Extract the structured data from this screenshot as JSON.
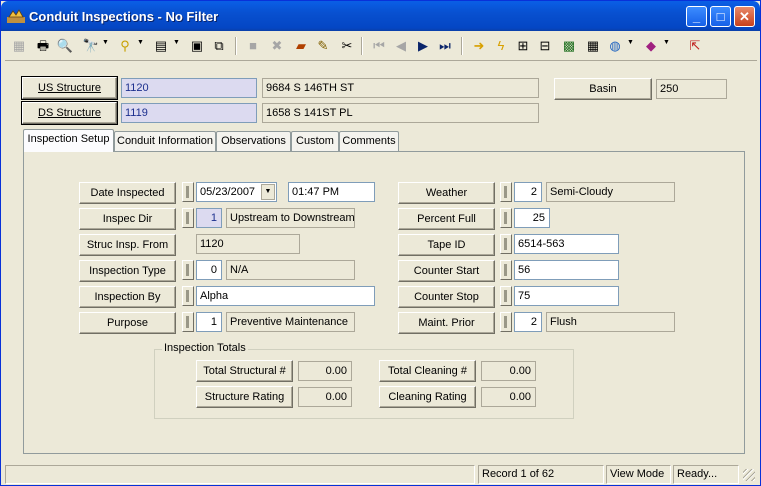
{
  "window": {
    "title": "Conduit Inspections - No Filter"
  },
  "header": {
    "us_structure_label": "US Structure",
    "us_structure_id": "1120",
    "us_structure_address": "9684  S  146TH ST",
    "ds_structure_label": "DS Structure",
    "ds_structure_id": "1119",
    "ds_structure_address": "1658  S  141ST PL",
    "basin_label": "Basin",
    "basin_value": "250"
  },
  "tabs": [
    {
      "label": "Inspection Setup"
    },
    {
      "label": "Conduit Information"
    },
    {
      "label": "Observations"
    },
    {
      "label": "Custom"
    },
    {
      "label": "Comments"
    }
  ],
  "left": {
    "date_inspected_label": "Date Inspected",
    "date_value": "05/23/2007",
    "time_value": "01:47 PM",
    "inspec_dir_label": "Inspec Dir",
    "inspec_dir_code": "1",
    "inspec_dir_text": "Upstream to Downstream",
    "struc_insp_from_label": "Struc Insp. From",
    "struc_insp_from_value": "1120",
    "inspection_type_label": "Inspection Type",
    "inspection_type_code": "0",
    "inspection_type_text": "N/A",
    "inspection_by_label": "Inspection By",
    "inspection_by_value": "Alpha",
    "purpose_label": "Purpose",
    "purpose_code": "1",
    "purpose_text": "Preventive Maintenance"
  },
  "right": {
    "weather_label": "Weather",
    "weather_code": "2",
    "weather_text": "Semi-Cloudy",
    "percent_full_label": "Percent Full",
    "percent_full_value": "25",
    "tape_id_label": "Tape ID",
    "tape_id_value": "6514-563",
    "counter_start_label": "Counter Start",
    "counter_start_value": "56",
    "counter_stop_label": "Counter Stop",
    "counter_stop_value": "75",
    "maint_prior_label": "Maint. Prior",
    "maint_prior_code": "2",
    "maint_prior_text": "Flush"
  },
  "totals": {
    "group_label": "Inspection Totals",
    "total_structural_label": "Total Structural #",
    "total_structural_value": "0.00",
    "structure_rating_label": "Structure Rating",
    "structure_rating_value": "0.00",
    "total_cleaning_label": "Total Cleaning #",
    "total_cleaning_value": "0.00",
    "cleaning_rating_label": "Cleaning Rating",
    "cleaning_rating_value": "0.00"
  },
  "status": {
    "record": "Record 1 of 62",
    "mode": "View Mode",
    "state": "Ready..."
  },
  "title_buttons": {
    "minimize": "_",
    "maximize": "□",
    "close": "✕"
  },
  "icons": {
    "first_record": "⏮",
    "prev_record": "◀",
    "next_record": "▶",
    "last_record": "⏭",
    "dropdown": "▼"
  },
  "colors": {
    "title_bar": "#0a5fe6",
    "lookup_field": "#dcdaf0",
    "window_bg": "#ece9d8"
  }
}
